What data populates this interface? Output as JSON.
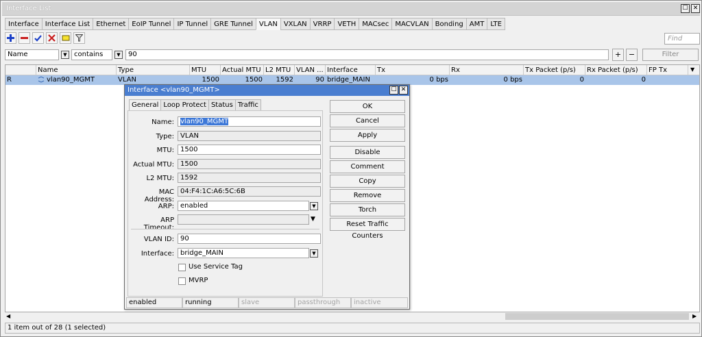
{
  "window": {
    "title": "Interface List",
    "restore_glyph": "☐",
    "close_glyph": "✕"
  },
  "tabs": [
    "Interface",
    "Interface List",
    "Ethernet",
    "EoIP Tunnel",
    "IP Tunnel",
    "GRE Tunnel",
    "VLAN",
    "VXLAN",
    "VRRP",
    "VETH",
    "MACsec",
    "MACVLAN",
    "Bonding",
    "AMT",
    "LTE"
  ],
  "active_tab": "VLAN",
  "toolbar": {
    "icons": [
      "add-icon",
      "remove-icon",
      "enable-icon",
      "disable-icon",
      "comment-icon",
      "filter-icon"
    ],
    "find_placeholder": "Find"
  },
  "filter": {
    "field": "Name",
    "op": "contains",
    "value": "90",
    "plus": "+",
    "minus": "−",
    "button": "Filter"
  },
  "table": {
    "columns": [
      "",
      "Name",
      "Type",
      "MTU",
      "Actual MTU",
      "L2 MTU",
      "VLAN ...",
      "Interface",
      "Tx",
      "Rx",
      "Tx Packet (p/s)",
      "Rx Packet (p/s)",
      "FP Tx"
    ],
    "rows": [
      {
        "flag": "R",
        "name": "vlan90_MGMT",
        "type": "VLAN",
        "mtu": "1500",
        "actual_mtu": "1500",
        "l2_mtu": "1592",
        "vlan_id": "90",
        "interface": "bridge_MAIN",
        "tx": "0 bps",
        "rx": "0 bps",
        "tx_packet": "0",
        "rx_packet": "0"
      }
    ]
  },
  "status_text": "1 item out of 28 (1 selected)",
  "dialog": {
    "title": "Interface <vlan90_MGMT>",
    "tabs": [
      "General",
      "Loop Protect",
      "Status",
      "Traffic"
    ],
    "fields": {
      "name": {
        "label": "Name:",
        "value": "vlan90_MGMT"
      },
      "type": {
        "label": "Type:",
        "value": "VLAN"
      },
      "mtu": {
        "label": "MTU:",
        "value": "1500"
      },
      "actual_mtu": {
        "label": "Actual MTU:",
        "value": "1500"
      },
      "l2_mtu": {
        "label": "L2 MTU:",
        "value": "1592"
      },
      "mac": {
        "label": "MAC Address:",
        "value": "04:F4:1C:A6:5C:6B"
      },
      "arp": {
        "label": "ARP:",
        "value": "enabled"
      },
      "arp_timeout": {
        "label": "ARP Timeout:",
        "value": ""
      },
      "vlan_id": {
        "label": "VLAN ID:",
        "value": "90"
      },
      "interface": {
        "label": "Interface:",
        "value": "bridge_MAIN"
      }
    },
    "checkboxes": {
      "service_tag": "Use Service Tag",
      "mvrp": "MVRP"
    },
    "buttons": [
      "OK",
      "Cancel",
      "Apply",
      "Disable",
      "Comment",
      "Copy",
      "Remove",
      "Torch",
      "Reset Traffic Counters"
    ],
    "status": [
      "enabled",
      "running",
      "slave",
      "passthrough",
      "inactive"
    ]
  },
  "colors": {
    "selection": "#a9c5e9",
    "dialog_title": "#4a7ed0",
    "add": "#1a3fc7",
    "remove": "#c81c1c"
  }
}
